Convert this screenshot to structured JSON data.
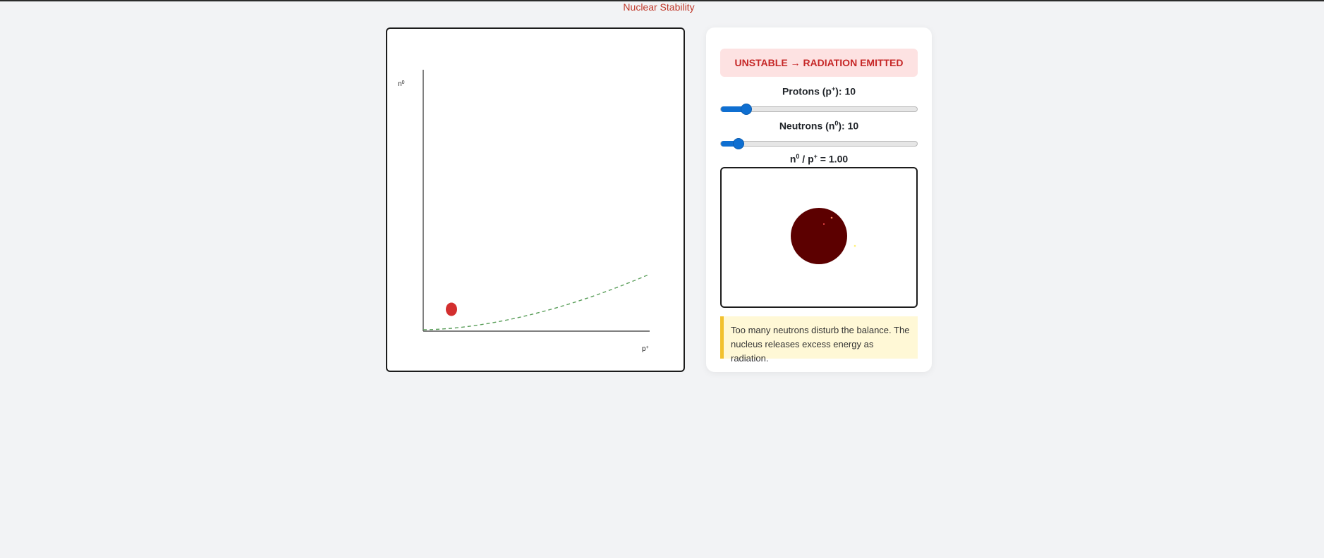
{
  "page": {
    "title": "Nuclear Stability"
  },
  "status": {
    "text": "UNSTABLE → RADIATION EMITTED",
    "color": "#c62828",
    "background": "#fde2e2"
  },
  "controls": {
    "protons": {
      "label_prefix": "Protons (p",
      "label_sup": "+",
      "label_suffix": "):",
      "value": "10",
      "fill_fraction": 0.13
    },
    "neutrons": {
      "label_prefix": "Neutrons (n",
      "label_sup": "0",
      "label_suffix": "):",
      "value": "10",
      "fill_fraction": 0.09
    }
  },
  "ratio": {
    "n_symbol": "n",
    "n_sup": "0",
    "slash": " / ",
    "p_symbol": "p",
    "p_sup": "+",
    "equals": " = ",
    "value": "1.00"
  },
  "info": {
    "text": "Too many neutrons disturb the balance. The nucleus releases excess energy as radiation."
  },
  "chart_data": {
    "type": "scatter",
    "x_axis_label": "p+",
    "y_axis_label": "n0",
    "point": {
      "x": 10,
      "y": 10,
      "color": "#d32f2f"
    },
    "stability_band": {
      "style": "dashed",
      "color": "#5a9e5a"
    }
  },
  "nucleus": {
    "core_color": "#5c0000",
    "particle_color": "#ff8a65",
    "emission_color": "#fff176"
  }
}
